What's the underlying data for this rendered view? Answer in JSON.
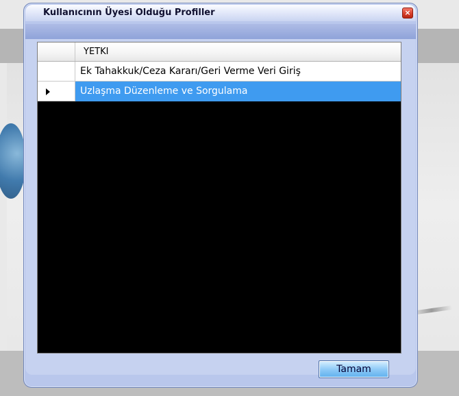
{
  "dialog": {
    "title": "Kullanıcının Üyesi Olduğu Profiller",
    "close_glyph": "×"
  },
  "grid": {
    "column_header": "YETKI",
    "rows": [
      {
        "label": "Ek Tahakkuk/Ceza Kararı/Geri Verme Veri Giriş",
        "selected": false
      },
      {
        "label": "Uzlaşma Düzenleme ve Sorgulama",
        "selected": true
      }
    ]
  },
  "footer": {
    "ok_label": "Tamam"
  },
  "colors": {
    "selection": "#3f9bf0",
    "grid_background": "#000000",
    "dialog_body": "#c6d2f0",
    "close_button": "#d53b27"
  }
}
